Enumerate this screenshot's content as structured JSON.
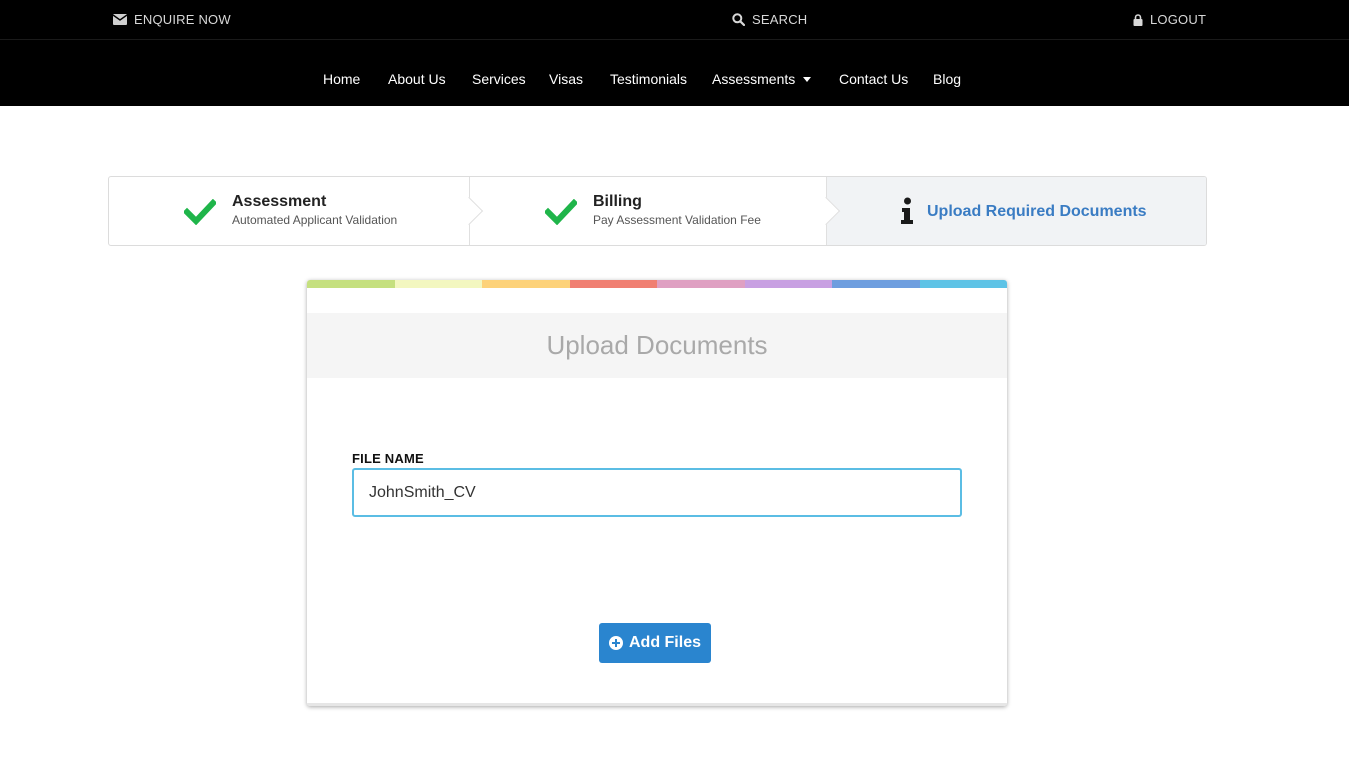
{
  "topbar": {
    "enquire_label": "ENQUIRE NOW",
    "search_label": "SEARCH",
    "logout_label": "LOGOUT"
  },
  "nav": {
    "items": [
      {
        "label": "Home"
      },
      {
        "label": "About Us"
      },
      {
        "label": "Services"
      },
      {
        "label": "Visas"
      },
      {
        "label": "Testimonials"
      },
      {
        "label": "Assessments"
      },
      {
        "label": "Contact Us"
      },
      {
        "label": "Blog"
      }
    ]
  },
  "steps": [
    {
      "title": "Assessment",
      "subtitle": "Automated Applicant Validation",
      "status": "complete"
    },
    {
      "title": "Billing",
      "subtitle": "Pay Assessment Validation Fee",
      "status": "complete"
    },
    {
      "title": "Upload Required Documents",
      "status": "current"
    }
  ],
  "card": {
    "title": "Upload Documents",
    "field_label": "FILE NAME",
    "file_name_value": "JohnSmith_CV",
    "add_files_label": "Add Files",
    "strip_colors": [
      "#c5e07f",
      "#f3f7c0",
      "#fdd27a",
      "#f07f72",
      "#dfa0c2",
      "#c8a0e2",
      "#6e9edf",
      "#5ec3e6"
    ]
  },
  "colors": {
    "accent_blue": "#3a7cc3",
    "button_blue": "#2a85cf",
    "check_green": "#1fb54a",
    "input_border": "#5bbde4"
  }
}
